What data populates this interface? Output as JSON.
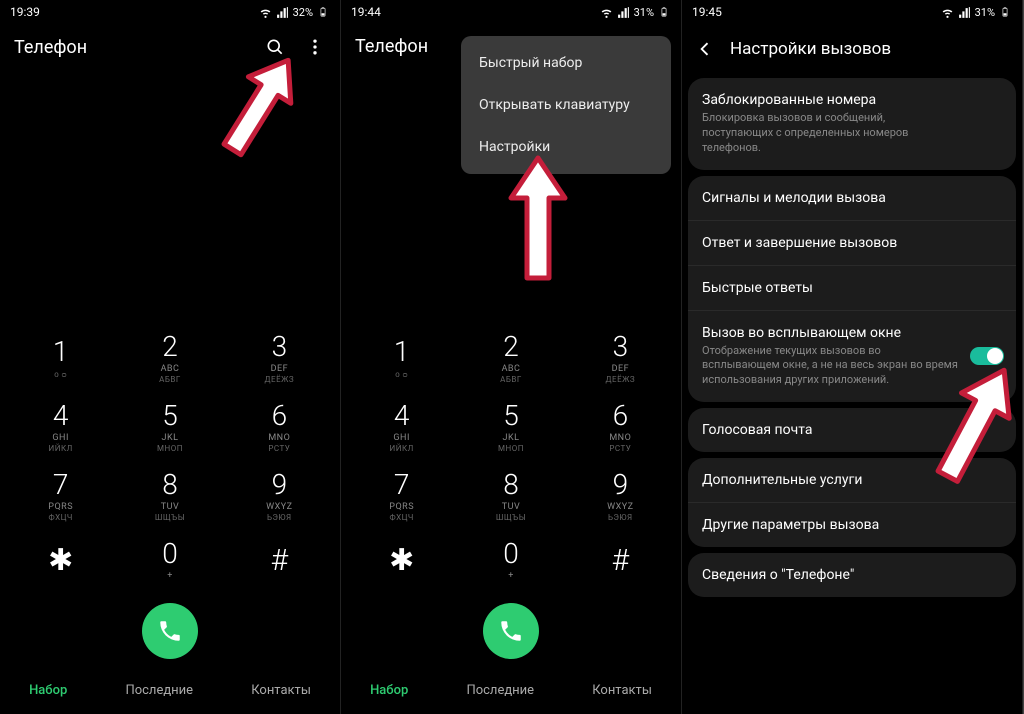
{
  "screen1": {
    "status": {
      "time": "19:39",
      "battery": "32%"
    },
    "header": {
      "title": "Телефон"
    },
    "keys": [
      {
        "d": "1",
        "s1": "",
        "s2": "ᴏ ᴑ"
      },
      {
        "d": "2",
        "s1": "ABC",
        "s2": "АБВГ"
      },
      {
        "d": "3",
        "s1": "DEF",
        "s2": "ДЕЁЖЗ"
      },
      {
        "d": "4",
        "s1": "GHI",
        "s2": "ИЙКЛ"
      },
      {
        "d": "5",
        "s1": "JKL",
        "s2": "МНОП"
      },
      {
        "d": "6",
        "s1": "MNO",
        "s2": "РСТУ"
      },
      {
        "d": "7",
        "s1": "PQRS",
        "s2": "ФХЦЧ"
      },
      {
        "d": "8",
        "s1": "TUV",
        "s2": "ШЩЪЫ"
      },
      {
        "d": "9",
        "s1": "WXYZ",
        "s2": "ЬЭЮЯ"
      },
      {
        "d": "✱",
        "s1": "",
        "s2": ""
      },
      {
        "d": "0",
        "s1": "+",
        "s2": ""
      },
      {
        "d": "#",
        "s1": "",
        "s2": ""
      }
    ],
    "tabs": {
      "dial": "Набор",
      "recent": "Последние",
      "contacts": "Контакты"
    }
  },
  "screen2": {
    "status": {
      "time": "19:44",
      "battery": "31%"
    },
    "header": {
      "title": "Телефон"
    },
    "menu": {
      "items": [
        "Быстрый набор",
        "Открывать клавиатуру",
        "Настройки"
      ]
    },
    "tabs": {
      "dial": "Набор",
      "recent": "Последние",
      "contacts": "Контакты"
    }
  },
  "screen3": {
    "status": {
      "time": "19:45",
      "battery": "31%"
    },
    "header": {
      "title": "Настройки вызовов"
    },
    "rows": {
      "blocked": {
        "title": "Заблокированные номера",
        "sub": "Блокировка вызовов и сообщений, поступающих с определенных номеров телефонов."
      },
      "ringtones": {
        "title": "Сигналы и мелодии вызова"
      },
      "answer": {
        "title": "Ответ и завершение вызовов"
      },
      "quick": {
        "title": "Быстрые ответы"
      },
      "popup": {
        "title": "Вызов во всплывающем окне",
        "sub": "Отображение текущих вызовов во всплывающем окне, а не на весь экран во время использования других приложений."
      },
      "voicemail": {
        "title": "Голосовая почта"
      },
      "extra": {
        "title": "Дополнительные услуги"
      },
      "other": {
        "title": "Другие параметры вызова"
      },
      "about": {
        "title": "Сведения о \"Телефоне\""
      }
    }
  }
}
